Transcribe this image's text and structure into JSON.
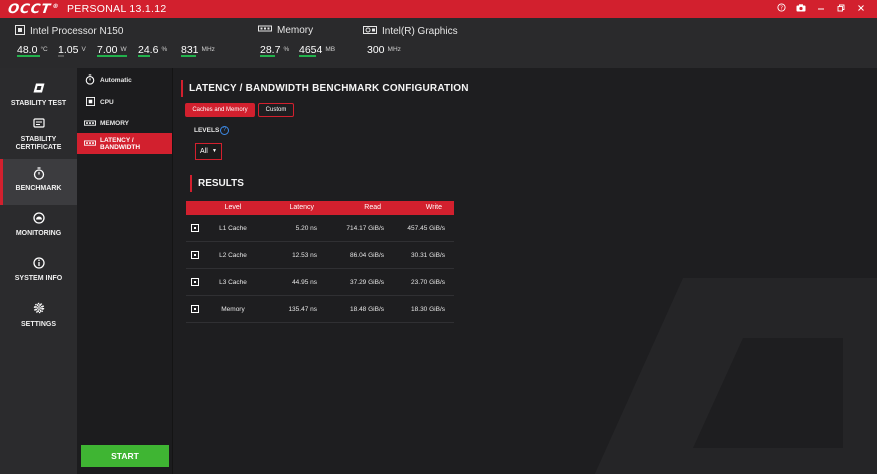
{
  "app": {
    "logo": "OCCT",
    "edition": "PERSONAL 13.1.12",
    "controls": [
      "?",
      "camera",
      "minimize",
      "restore",
      "close"
    ]
  },
  "stats": {
    "cpu": {
      "name": "Intel Processor N150",
      "metrics": [
        {
          "value": "48.0",
          "unit": "°C",
          "fill": 0.48
        },
        {
          "value": "1.05",
          "unit": "V",
          "fill": 0.0
        },
        {
          "value": "7.00",
          "unit": "W",
          "fill": 0.7
        },
        {
          "value": "24.6",
          "unit": "%",
          "fill": 0.25
        },
        {
          "value": "831",
          "unit": "MHz",
          "fill": 0.28
        }
      ]
    },
    "memory": {
      "name": "Memory",
      "metrics": [
        {
          "value": "28.7",
          "unit": "%",
          "fill": 0.29
        },
        {
          "value": "4654",
          "unit": "MB",
          "fill": 0.3
        }
      ]
    },
    "gpu": {
      "name": "Intel(R) Graphics",
      "metrics": [
        {
          "value": "300",
          "unit": "MHz",
          "fill": 0.0
        }
      ]
    }
  },
  "nav": {
    "items": [
      {
        "label": "STABILITY TEST",
        "icon": "occt-logo-icon"
      },
      {
        "label": "STABILITY",
        "label2": "CERTIFICATE",
        "icon": "certificate-icon"
      },
      {
        "label": "BENCHMARK",
        "icon": "stopwatch-icon"
      },
      {
        "label": "MONITORING",
        "icon": "gauge-icon"
      },
      {
        "label": "SYSTEM INFO",
        "icon": "info-icon"
      },
      {
        "label": "SETTINGS",
        "icon": "gear-icon"
      }
    ]
  },
  "subnav": {
    "items": [
      {
        "label": "Automatic",
        "icon": "stopwatch-icon"
      },
      {
        "label": "CPU",
        "icon": "cpu-icon"
      },
      {
        "label": "MEMORY",
        "icon": "memory-icon"
      },
      {
        "label": "LATENCY / BANDWIDTH",
        "icon": "memory-icon"
      }
    ],
    "start": "START"
  },
  "config": {
    "title": "LATENCY / BANDWIDTH BENCHMARK CONFIGURATION",
    "tabs": [
      "Caches and Memory",
      "Custom"
    ],
    "levels_label": "LEVELS",
    "levels_value": "All"
  },
  "results": {
    "title": "RESULTS",
    "columns": [
      "Level",
      "Latency",
      "Read",
      "Write"
    ],
    "rows": [
      {
        "level": "L1 Cache",
        "latency": "5.20 ns",
        "read": "714.17 GiB/s",
        "write": "457.45 GiB/s"
      },
      {
        "level": "L2 Cache",
        "latency": "12.53 ns",
        "read": "86.04 GiB/s",
        "write": "30.31 GiB/s"
      },
      {
        "level": "L3 Cache",
        "latency": "44.95 ns",
        "read": "37.29 GiB/s",
        "write": "23.70 GiB/s"
      },
      {
        "level": "Memory",
        "latency": "135.47 ns",
        "read": "18.48 GiB/s",
        "write": "18.30 GiB/s"
      }
    ]
  },
  "colors": {
    "accent": "#d2202e",
    "start": "#3fb533",
    "metric_bar": "#22b14c"
  }
}
